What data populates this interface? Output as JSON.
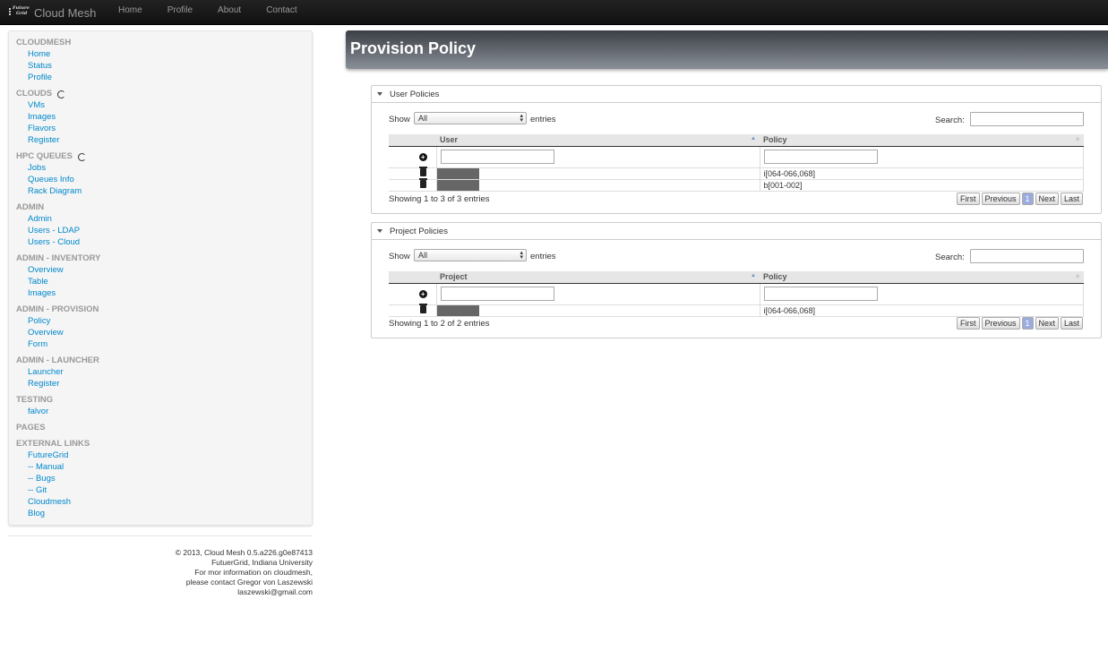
{
  "navbar": {
    "logo_line1": "Future",
    "logo_line2": "Grid",
    "brand": "Cloud Mesh",
    "links": [
      "Home",
      "Profile",
      "About",
      "Contact"
    ]
  },
  "sidebar": {
    "groups": [
      {
        "header": "CLOUDMESH",
        "spinner": false,
        "items": [
          "Home",
          "Status",
          "Profile"
        ]
      },
      {
        "header": "CLOUDS",
        "spinner": true,
        "items": [
          "VMs",
          "Images",
          "Flavors",
          "Register"
        ]
      },
      {
        "header": "HPC QUEUES",
        "spinner": true,
        "items": [
          "Jobs",
          "Queues Info",
          "Rack Diagram"
        ]
      },
      {
        "header": "ADMIN",
        "spinner": false,
        "items": [
          "Admin",
          "Users - LDAP",
          "Users - Cloud"
        ]
      },
      {
        "header": "ADMIN - INVENTORY",
        "spinner": false,
        "items": [
          "Overview",
          "Table",
          "Images"
        ]
      },
      {
        "header": "ADMIN - PROVISION",
        "spinner": false,
        "items": [
          "Policy",
          "Overview",
          "Form"
        ]
      },
      {
        "header": "ADMIN - LAUNCHER",
        "spinner": false,
        "items": [
          "Launcher",
          "Register"
        ]
      },
      {
        "header": "TESTING",
        "spinner": false,
        "items": [
          "falvor"
        ]
      },
      {
        "header": "PAGES",
        "spinner": false,
        "items": []
      },
      {
        "header": "EXTERNAL LINKS",
        "spinner": false,
        "items": [
          "FutureGrid",
          "-- Manual",
          "-- Bugs",
          "-- Git",
          "Cloudmesh",
          "Blog"
        ]
      }
    ]
  },
  "footer": {
    "lines": [
      "© 2013, Cloud Mesh 0.5.a226.g0e87413",
      "FutuerGrid, Indiana University",
      "For mor information on cloudmesh,",
      "please contact Gregor von Laszewski",
      "laszewski@gmail.com"
    ]
  },
  "page": {
    "title": "Provision Policy"
  },
  "user_panel": {
    "title": "User Policies",
    "show_label": "Show",
    "show_value": "All",
    "entries_label": "entries",
    "search_label": "Search:",
    "columns": [
      "User",
      "Policy"
    ],
    "rows": [
      {
        "policy": "i[064-066,068]"
      },
      {
        "policy": "b[001-002]"
      }
    ],
    "info": "Showing 1 to 3 of 3 entries",
    "pager": {
      "first": "First",
      "previous": "Previous",
      "page": "1",
      "next": "Next",
      "last": "Last"
    }
  },
  "project_panel": {
    "title": "Project Policies",
    "show_label": "Show",
    "show_value": "All",
    "entries_label": "entries",
    "search_label": "Search:",
    "columns": [
      "Project",
      "Policy"
    ],
    "rows": [
      {
        "policy": "i[064-066,068]"
      }
    ],
    "info": "Showing 1 to 2 of 2 entries",
    "pager": {
      "first": "First",
      "previous": "Previous",
      "page": "1",
      "next": "Next",
      "last": "Last"
    }
  }
}
